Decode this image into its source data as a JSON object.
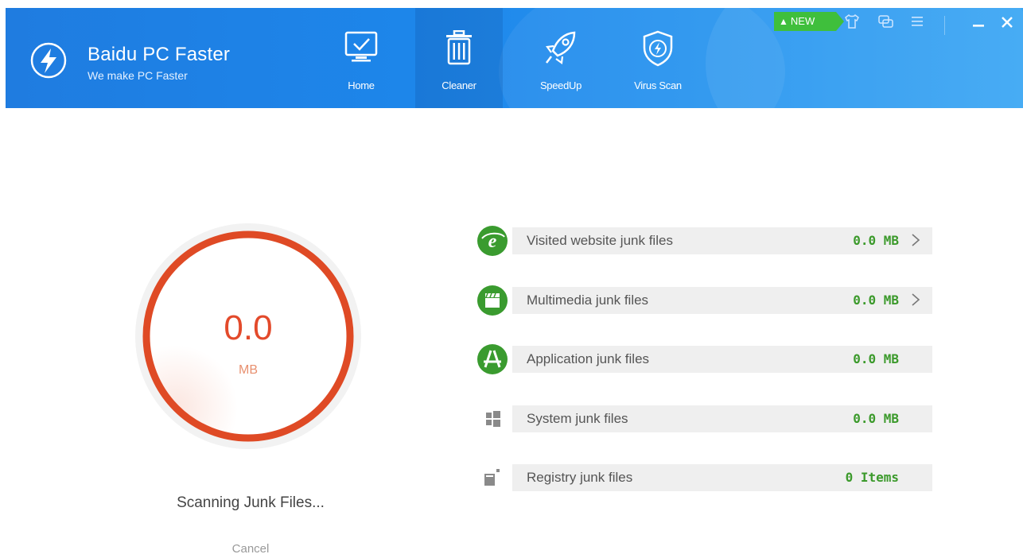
{
  "app": {
    "title": "Baidu PC Faster",
    "subtitle": "We make PC Faster"
  },
  "nav": [
    {
      "label": "Home",
      "icon": "monitor-check-icon"
    },
    {
      "label": "Cleaner",
      "icon": "trash-icon",
      "active": true
    },
    {
      "label": "SpeedUp",
      "icon": "rocket-icon"
    },
    {
      "label": "Virus Scan",
      "icon": "shield-bolt-icon"
    }
  ],
  "topbar": {
    "new_badge": "NEW",
    "icons": [
      "tshirt-icon",
      "feedback-icon",
      "menu-icon"
    ],
    "window_controls": [
      "minimize-icon",
      "close-icon"
    ]
  },
  "scan": {
    "value": "0.0",
    "unit": "MB",
    "status": "Scanning Junk Files...",
    "cancel": "Cancel"
  },
  "junk_items": [
    {
      "label": "Visited website junk files",
      "value": "0.0 MB",
      "icon": "browser-icon",
      "has_arrow": true
    },
    {
      "label": "Multimedia junk files",
      "value": "0.0 MB",
      "icon": "clapperboard-icon",
      "has_arrow": true
    },
    {
      "label": "Application junk files",
      "value": "0.0 MB",
      "icon": "app-store-icon",
      "has_arrow": false
    },
    {
      "label": "System junk files",
      "value": "0.0 MB",
      "icon": "windows-icon",
      "has_arrow": false
    },
    {
      "label": "Registry junk files",
      "value": "0 Items",
      "icon": "registry-icon",
      "has_arrow": false
    }
  ],
  "colors": {
    "header": "#1d86ea",
    "accent_red": "#e34a2b",
    "green": "#3fbf3c",
    "value_green": "#3c9a2c"
  }
}
